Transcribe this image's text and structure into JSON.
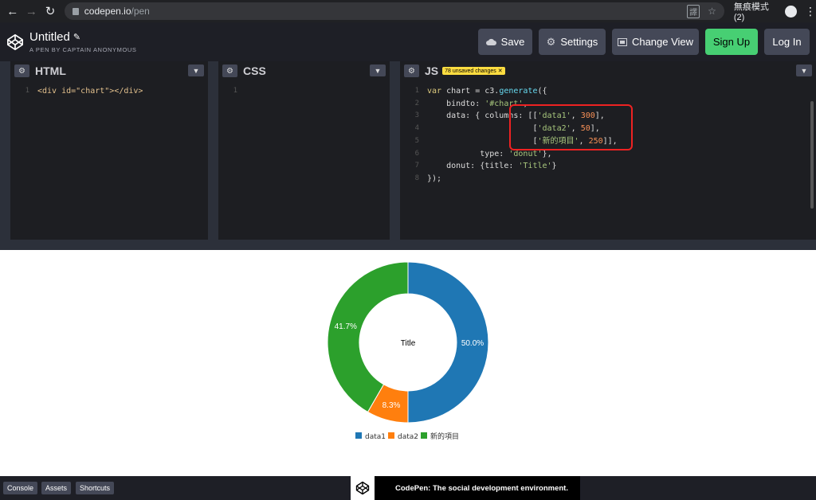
{
  "browser": {
    "url_host": "codepen.io",
    "url_path": "/pen",
    "profile_label": "無痕模式 (2)"
  },
  "header": {
    "title": "Untitled",
    "subtitle": "A PEN BY CAPTAIN ANONYMOUS",
    "save_label": "Save",
    "settings_label": "Settings",
    "change_view_label": "Change View",
    "signup_label": "Sign Up",
    "login_label": "Log In"
  },
  "editors": {
    "html_label": "HTML",
    "css_label": "CSS",
    "js_label": "JS",
    "unsaved_badge": "78 unsaved changes",
    "html_code": "<div id=\"chart\"></div>",
    "css_code": "",
    "js_line_numbers": [
      "1",
      "2",
      "3",
      "4",
      "5",
      "6",
      "7",
      "8"
    ]
  },
  "chart_data": {
    "type": "donut",
    "title": "Title",
    "series": [
      {
        "name": "data1",
        "value": 300,
        "label": "50.0%",
        "color": "#1f77b4"
      },
      {
        "name": "data2",
        "value": 50,
        "label": "8.3%",
        "color": "#ff7f0e"
      },
      {
        "name": "新的項目",
        "value": 250,
        "label": "41.7%",
        "color": "#2ca02c"
      }
    ],
    "legend_position": "bottom"
  },
  "footer": {
    "console_label": "Console",
    "assets_label": "Assets",
    "shortcuts_label": "Shortcuts",
    "promo_text": "CodePen: The social development environment."
  }
}
